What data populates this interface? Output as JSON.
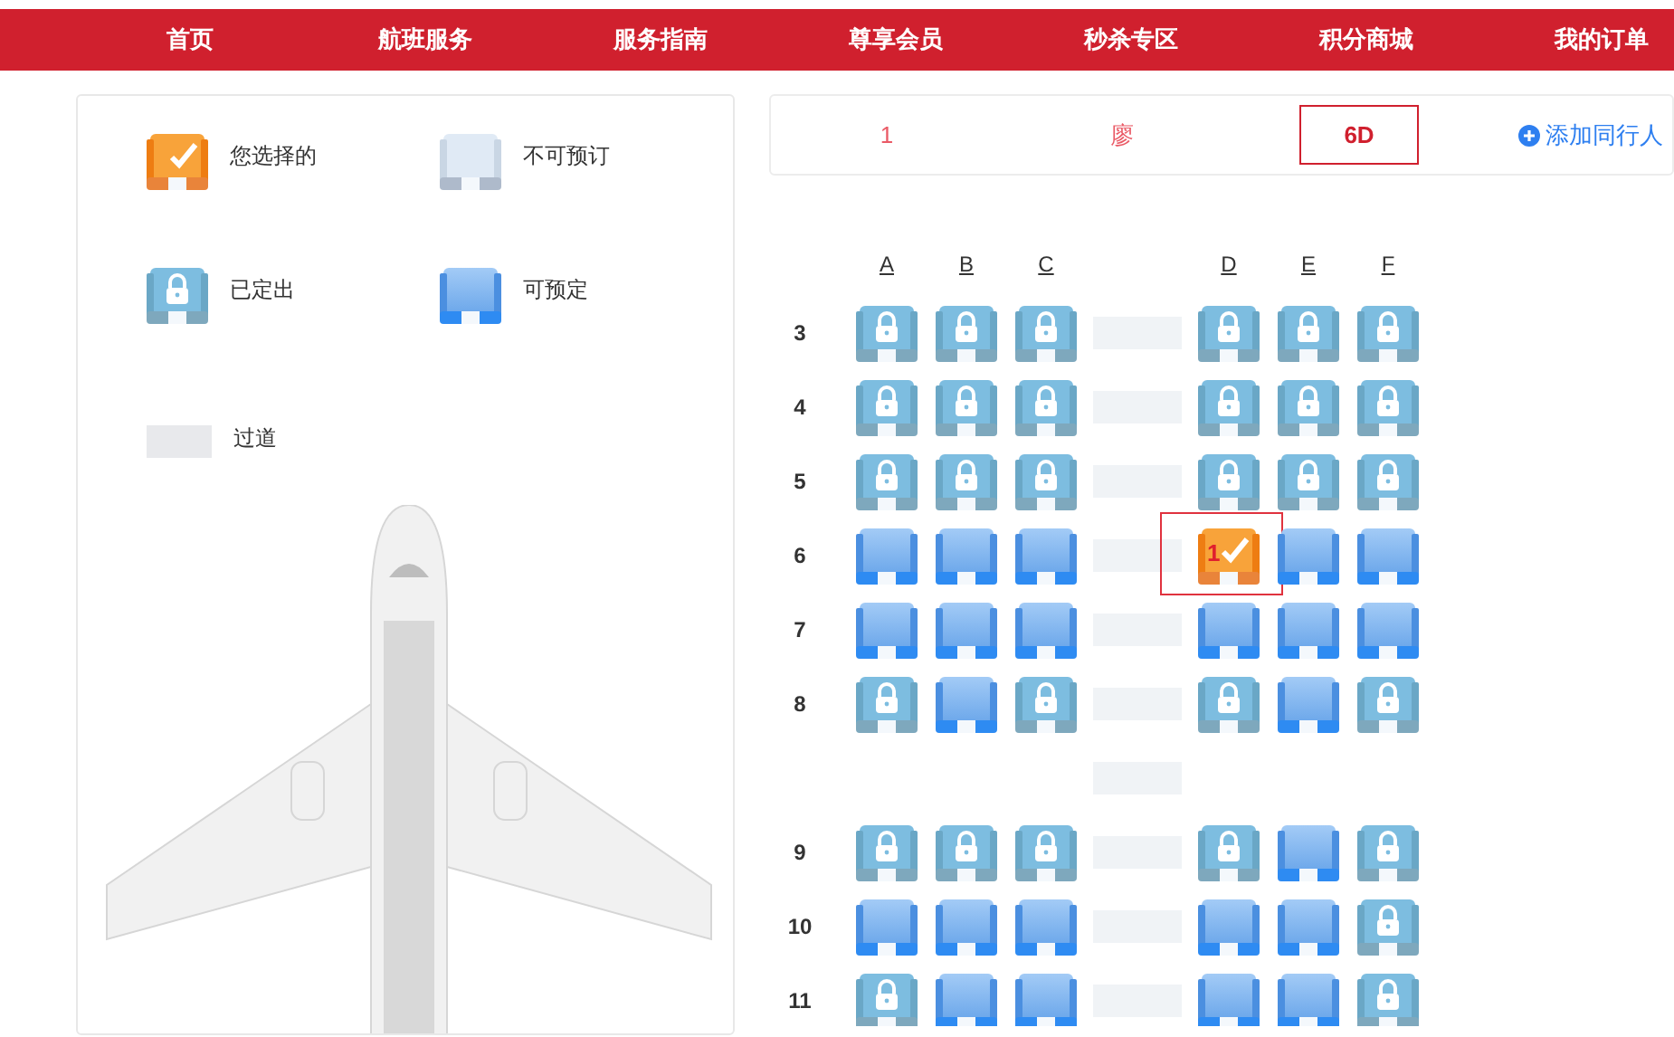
{
  "nav": [
    {
      "label": "首页"
    },
    {
      "label": "航班服务"
    },
    {
      "label": "服务指南"
    },
    {
      "label": "尊享会员"
    },
    {
      "label": "秒杀专区"
    },
    {
      "label": "积分商城"
    },
    {
      "label": "我的订单"
    }
  ],
  "legend": [
    {
      "kind": "selected",
      "label": "您选择的"
    },
    {
      "kind": "unavailable",
      "label": "不可预订"
    },
    {
      "kind": "sold",
      "label": "已定出"
    },
    {
      "kind": "available",
      "label": "可预定"
    },
    {
      "kind": "aisle",
      "label": "过道"
    }
  ],
  "passenger": {
    "number": "1",
    "name": "廖",
    "seat": "6D",
    "add_button": "添加同行人"
  },
  "columns": [
    "A",
    "B",
    "C",
    "D",
    "E",
    "F"
  ],
  "rows": [
    {
      "kind": "seats",
      "label": "3",
      "seats": [
        {
          "sold": true,
          "selected": false
        },
        {
          "sold": true,
          "selected": false
        },
        {
          "sold": true,
          "selected": false
        },
        {
          "sold": true,
          "selected": false
        },
        {
          "sold": true,
          "selected": false
        },
        {
          "sold": true,
          "selected": false
        }
      ]
    },
    {
      "kind": "seats",
      "label": "4",
      "seats": [
        {
          "sold": true,
          "selected": false
        },
        {
          "sold": true,
          "selected": false
        },
        {
          "sold": true,
          "selected": false
        },
        {
          "sold": true,
          "selected": false
        },
        {
          "sold": true,
          "selected": false
        },
        {
          "sold": true,
          "selected": false
        }
      ]
    },
    {
      "kind": "seats",
      "label": "5",
      "seats": [
        {
          "sold": true,
          "selected": false
        },
        {
          "sold": true,
          "selected": false
        },
        {
          "sold": true,
          "selected": false
        },
        {
          "sold": true,
          "selected": false
        },
        {
          "sold": true,
          "selected": false
        },
        {
          "sold": true,
          "selected": false
        }
      ]
    },
    {
      "kind": "seats",
      "label": "6",
      "seats": [
        {
          "sold": false,
          "selected": false
        },
        {
          "sold": false,
          "selected": false
        },
        {
          "sold": false,
          "selected": false
        },
        {
          "sold": false,
          "selected": true,
          "label": "1"
        },
        {
          "sold": false,
          "selected": false
        },
        {
          "sold": false,
          "selected": false
        }
      ]
    },
    {
      "kind": "seats",
      "label": "7",
      "seats": [
        {
          "sold": false,
          "selected": false
        },
        {
          "sold": false,
          "selected": false
        },
        {
          "sold": false,
          "selected": false
        },
        {
          "sold": false,
          "selected": false
        },
        {
          "sold": false,
          "selected": false
        },
        {
          "sold": false,
          "selected": false
        }
      ]
    },
    {
      "kind": "seats",
      "label": "8",
      "seats": [
        {
          "sold": true,
          "selected": false
        },
        {
          "sold": false,
          "selected": false
        },
        {
          "sold": true,
          "selected": false
        },
        {
          "sold": true,
          "selected": false
        },
        {
          "sold": false,
          "selected": false
        },
        {
          "sold": true,
          "selected": false
        }
      ]
    },
    {
      "kind": "gap"
    },
    {
      "kind": "seats",
      "label": "9",
      "seats": [
        {
          "sold": true,
          "selected": false
        },
        {
          "sold": true,
          "selected": false
        },
        {
          "sold": true,
          "selected": false
        },
        {
          "sold": true,
          "selected": false
        },
        {
          "sold": false,
          "selected": false
        },
        {
          "sold": true,
          "selected": false
        }
      ]
    },
    {
      "kind": "seats",
      "label": "10",
      "seats": [
        {
          "sold": false,
          "selected": false
        },
        {
          "sold": false,
          "selected": false
        },
        {
          "sold": false,
          "selected": false
        },
        {
          "sold": false,
          "selected": false
        },
        {
          "sold": false,
          "selected": false
        },
        {
          "sold": true,
          "selected": false
        }
      ]
    },
    {
      "kind": "seats",
      "label": "11",
      "seats": [
        {
          "sold": true,
          "selected": false
        },
        {
          "sold": false,
          "selected": false
        },
        {
          "sold": false,
          "selected": false
        },
        {
          "sold": false,
          "selected": false
        },
        {
          "sold": false,
          "selected": false
        },
        {
          "sold": true,
          "selected": false
        }
      ]
    }
  ]
}
